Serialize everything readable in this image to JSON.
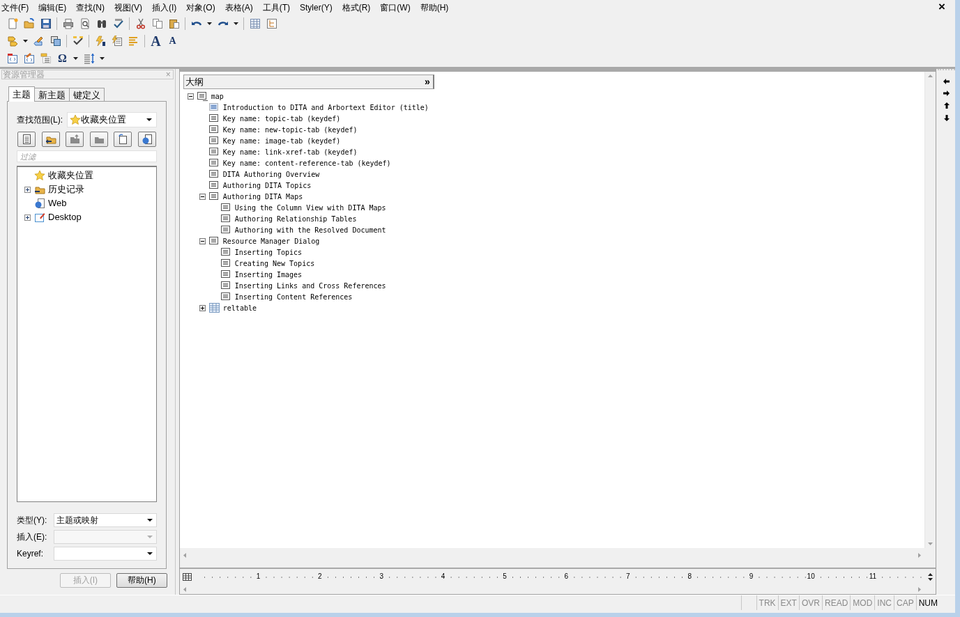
{
  "menu": [
    "文件(F)",
    "编辑(E)",
    "查找(N)",
    "视图(V)",
    "插入(I)",
    "对象(O)",
    "表格(A)",
    "工具(T)",
    "Styler(Y)",
    "格式(R)",
    "窗口(W)",
    "帮助(H)"
  ],
  "close_glyph": "×",
  "toolbar_glyphs": {
    "font_larger": "A",
    "font_smaller": "A",
    "special_character": "Ω"
  },
  "resource_manager": {
    "title": "资源管理器",
    "close_glyph": "×",
    "tabs": [
      {
        "label": "主题",
        "selected": true
      },
      {
        "label": "新主题",
        "selected": false
      },
      {
        "label": "键定义",
        "selected": false
      }
    ],
    "scope_label": "查找范围(L):",
    "scope_value": "收藏夹位置",
    "filter_placeholder": "过滤",
    "tree": [
      {
        "label": "收藏夹位置",
        "kind": "favorites"
      },
      {
        "label": "历史记录",
        "kind": "history",
        "expanded": false
      },
      {
        "label": "Web",
        "kind": "web"
      },
      {
        "label": "Desktop",
        "kind": "desktop",
        "expanded": false
      }
    ],
    "type_label": "类型(Y):",
    "type_value": "主题或映射",
    "insert_label": "插入(E):",
    "insert_disabled": true,
    "keyref_label": "Keyref:",
    "buttons": [
      {
        "label": "插入(I)",
        "disabled": true
      },
      {
        "label": "帮助(H)",
        "disabled": false
      }
    ]
  },
  "outline": {
    "title": "大纲",
    "expand_glyph": "»",
    "tree": [
      {
        "label": "map",
        "kind": "map",
        "expanded": true,
        "children": [
          {
            "label": "Introduction to DITA and Arbortext Editor (title)",
            "kind": "title"
          },
          {
            "label": "Key name: topic-tab (keydef)",
            "kind": "topic"
          },
          {
            "label": "Key name: new-topic-tab (keydef)",
            "kind": "topic"
          },
          {
            "label": "Key name: image-tab (keydef)",
            "kind": "topic"
          },
          {
            "label": "Key name: link-xref-tab (keydef)",
            "kind": "topic"
          },
          {
            "label": "Key name: content-reference-tab (keydef)",
            "kind": "topic"
          },
          {
            "label": "DITA Authoring Overview",
            "kind": "topic"
          },
          {
            "label": "Authoring DITA Topics",
            "kind": "topic"
          },
          {
            "label": "Authoring DITA Maps",
            "kind": "topic",
            "expanded": true,
            "children": [
              {
                "label": "Using the Column View with DITA Maps",
                "kind": "topic"
              },
              {
                "label": "Authoring Relationship Tables",
                "kind": "topic"
              },
              {
                "label": "Authoring with the Resolved Document",
                "kind": "topic"
              }
            ]
          },
          {
            "label": "Resource Manager Dialog",
            "kind": "topic",
            "expanded": true,
            "children": [
              {
                "label": "Inserting Topics",
                "kind": "topic"
              },
              {
                "label": "Creating New Topics",
                "kind": "topic"
              },
              {
                "label": "Inserting Images",
                "kind": "topic"
              },
              {
                "label": "Inserting Links and Cross References",
                "kind": "topic"
              },
              {
                "label": "Inserting Content References",
                "kind": "topic"
              }
            ]
          },
          {
            "label": "reltable",
            "kind": "table",
            "expanded": false
          }
        ]
      }
    ]
  },
  "ruler": {
    "labels": [
      "1",
      "2",
      "3",
      "4",
      "5",
      "6",
      "7",
      "8",
      "9",
      "10",
      "11"
    ]
  },
  "status_bar": {
    "indicators": [
      {
        "label": "TRK",
        "on": false
      },
      {
        "label": "EXT",
        "on": false
      },
      {
        "label": "OVR",
        "on": false
      },
      {
        "label": "READ",
        "on": false
      },
      {
        "label": "MOD",
        "on": false
      },
      {
        "label": "INC",
        "on": false
      },
      {
        "label": "CAP",
        "on": false
      },
      {
        "label": "NUM",
        "on": true
      }
    ]
  }
}
